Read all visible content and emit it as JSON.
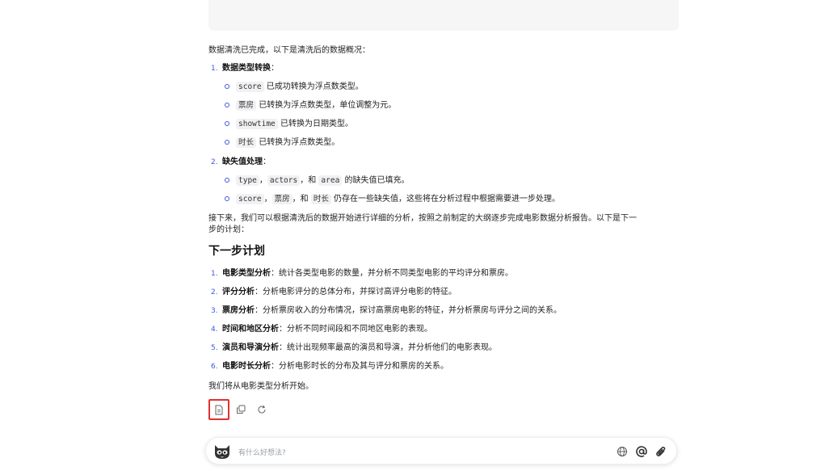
{
  "intro": "数据清洗已完成，以下是清洗后的数据概况：",
  "section1": {
    "num": "1.",
    "title": "数据类型转换",
    "colon": "：",
    "items": [
      {
        "code": "score",
        "text": " 已成功转换为浮点数类型。"
      },
      {
        "code": "票房",
        "text": " 已转换为浮点数类型，单位调整为元。"
      },
      {
        "code": "showtime",
        "text": " 已转换为日期类型。"
      },
      {
        "code": "时长",
        "text": " 已转换为浮点数类型。"
      }
    ]
  },
  "section2": {
    "num": "2.",
    "title": "缺失值处理",
    "colon": "：",
    "item1": {
      "code1": "type",
      "sep1": "，",
      "code2": "actors",
      "sep2": "，和 ",
      "code3": "area",
      "text": " 的缺失值已填充。"
    },
    "item2": {
      "code1": "score",
      "sep1": "，",
      "code2": "票房",
      "sep2": "，和 ",
      "code3": "时长",
      "text": " 仍存在一些缺失值，这些将在分析过程中根据需要进一步处理。"
    }
  },
  "next_para_line1": "接下来，我们可以根据清洗后的数据开始进行详细的分析，按照之前制定的大纲逐步完成电影数据分析报告。以下是下一",
  "next_para_line2": "步的计划：",
  "heading": "下一步计划",
  "plan": [
    {
      "num": "1.",
      "title": "电影类型分析",
      "text": "：统计各类型电影的数量，并分析不同类型电影的平均评分和票房。"
    },
    {
      "num": "2.",
      "title": "评分分析",
      "text": "：分析电影评分的总体分布，并探讨高评分电影的特征。"
    },
    {
      "num": "3.",
      "title": "票房分析",
      "text": "：分析票房收入的分布情况，探讨高票房电影的特征，并分析票房与评分之间的关系。"
    },
    {
      "num": "4.",
      "title": "时间和地区分析",
      "text": "：分析不同时间段和不同地区电影的表现。"
    },
    {
      "num": "5.",
      "title": "演员和导演分析",
      "text": "：统计出现频率最高的演员和导演，并分析他们的电影表现。"
    },
    {
      "num": "6.",
      "title": "电影时长分析",
      "text": "：分析电影时长的分布及其与评分和票房的关系。"
    }
  ],
  "closing": "我们将从电影类型分析开始。",
  "input": {
    "placeholder": "有什么好想法?"
  },
  "icons": {
    "doc": "document-icon",
    "copy": "copy-icon",
    "refresh": "refresh-icon",
    "globe": "globe-icon",
    "at": "at-icon",
    "attach": "paperclip-icon"
  },
  "colors": {
    "accent": "#3b5bdb",
    "highlight": "#e03131"
  }
}
